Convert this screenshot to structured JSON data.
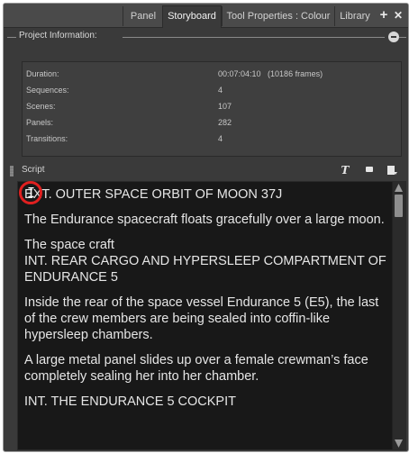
{
  "tabs": [
    {
      "label": "Panel",
      "active": false
    },
    {
      "label": "Storyboard",
      "active": true
    },
    {
      "label": "Tool Properties : Colour",
      "active": false
    },
    {
      "label": "Library",
      "active": false
    }
  ],
  "tab_controls": {
    "add": "+",
    "close": "✕"
  },
  "project_info": {
    "title": "Project Information:",
    "rows": [
      {
        "label": "Duration:",
        "value": "00:07:04:10   (10186 frames)"
      },
      {
        "label": "Sequences:",
        "value": "4"
      },
      {
        "label": "Scenes:",
        "value": "107"
      },
      {
        "label": "Panels:",
        "value": "282"
      },
      {
        "label": "Transitions:",
        "value": "4"
      }
    ]
  },
  "script": {
    "label": "Script",
    "toolbar_icons": [
      "text-style-icon",
      "record-icon",
      "export-icon"
    ],
    "paragraphs": [
      "EXT. OUTER SPACE ORBIT OF MOON 37J",
      "The Endurance spacecraft floats gracefully over a large moon.",
      "The space craft\nINT. REAR CARGO AND HYPERSLEEP COMPARTMENT OF ENDURANCE 5",
      "Inside the rear of the space vessel Endurance 5 (E5), the last of the crew members are being sealed into coffin-like hypersleep chambers.",
      "A large metal panel slides up over a female crewman’s face completely sealing her into her chamber.",
      "INT. THE ENDURANCE 5 COCKPIT"
    ]
  },
  "colors": {
    "panel_bg": "#3a3a3a",
    "editor_bg": "#181818",
    "highlight_ring": "#e02020"
  }
}
